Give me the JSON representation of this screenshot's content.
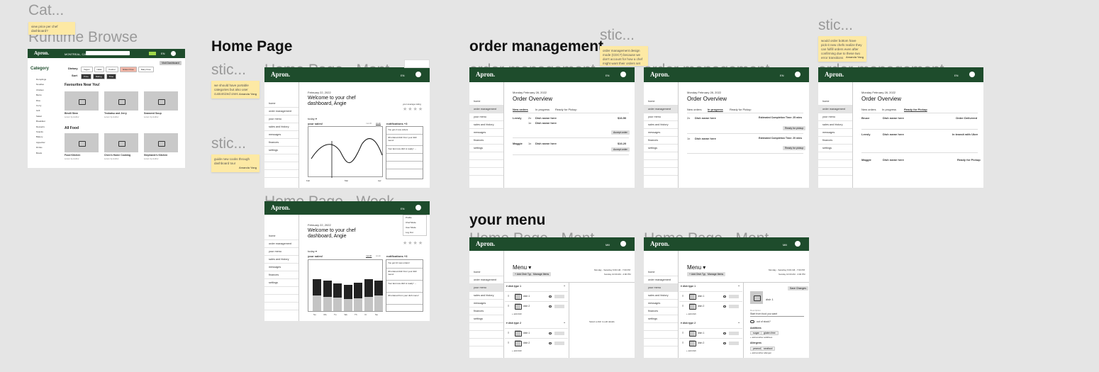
{
  "canvas_labels": {
    "cat": "Cat...",
    "runtime_browse": "Runtime Browse",
    "stic": "stic...",
    "home_mont": "Home Page - Mont",
    "home_week": "Home Page - Week",
    "order_mgmt": "order management",
    "menu_mont": "Home Page - Mont"
  },
  "sections": {
    "home": "Home Page",
    "order": "order management",
    "menu": "your menu"
  },
  "sticky": {
    "who": "Amanda May",
    "who2": "Amanda Yang"
  },
  "app": {
    "logo": "Apron.",
    "lang": "EN",
    "lang2": "Mili"
  },
  "browse": {
    "location": "MONTREAL, CA",
    "cart_label": "Visit Dashboard",
    "sidebar_title": "Category",
    "sidebar_items": [
      "Dumplings",
      "Noodles",
      "Chicken",
      "Bento",
      "Rice",
      "Curry",
      "Grill",
      "Salad",
      "Breakfast",
      "Desserts",
      "Snacks",
      "Bakery",
      "Appetizer",
      "Drinks",
      "Bowls"
    ],
    "dietary_label": "Dietary",
    "dietary_chips": [
      "Vegan",
      "Halal",
      "Kosher",
      "Gluten Free",
      "Dairy Free"
    ],
    "sort_label": "Sort",
    "sort_chips": [
      "Price",
      "Rating",
      "Time"
    ],
    "fav_title": "Favourites Near You!",
    "all_title": "All Food",
    "fav_cards": [
      {
        "name": "Bindli Stew",
        "sub": "Lorem by Author"
      },
      {
        "name": "Teokatsu and Jerry",
        "sub": "Lorem by Author"
      },
      {
        "name": "Seaweed Soup",
        "sub": "Lorem by Author"
      }
    ],
    "all_cards": [
      {
        "name": "Food Kitchen",
        "sub": "Lorem by Author"
      },
      {
        "name": "Chen's Home Cooking",
        "sub": "Lorem by Author"
      },
      {
        "name": "Stephanie's Kitchen",
        "sub": "Lorem by Author"
      }
    ]
  },
  "home_nav": [
    "home",
    "order management",
    "your menu",
    "sales and history",
    "messages",
    "finances",
    "settings"
  ],
  "home_month": {
    "date": "February 22, 2022",
    "welcome_line1": "Welcome to your chef",
    "welcome_line2": "dashboard, Angie",
    "rating_label": "your average rating",
    "period": "today",
    "sales_label": "your sales!",
    "tab_month": "month",
    "tab_week": "week",
    "notif": "notifications +3",
    "notif_items": [
      "You got 2 new orders",
      "Jill ordered dish from your dish menu!",
      "Your last new dish is ready! →"
    ],
    "x_ticks": [
      "Feb",
      "Mar",
      "Apr"
    ]
  },
  "home_week": {
    "date": "February 22, 2022",
    "welcome_line1": "Welcome to your chef",
    "welcome_line2": "dashboard, Angie",
    "period": "today",
    "sales_label": "your sales!",
    "tab_month": "month",
    "tab_week": "week",
    "notif": "notifications +3",
    "notif_items": [
      "You got 10 new orders!",
      "Jill ordered dish from your dish menu!",
      "Your last new dish is ready! →",
      "Jill ordered from your dish menu!"
    ],
    "days": [
      "Su",
      "Mo",
      "Tu",
      "We",
      "Th",
      "Fr",
      "Sa"
    ],
    "dropdown": [
      "Profile",
      "Chef Mode",
      "User Mode",
      "Log Out"
    ]
  },
  "orders": {
    "date": "Monday February 28, 2022",
    "title": "Order Overview",
    "tabs": [
      "New orders",
      "In progress",
      "Ready for Pickup"
    ],
    "customers": [
      {
        "name": "Leesly",
        "items": [
          {
            "qty": "2x",
            "dish": "Dish name here"
          },
          {
            "qty": "1x",
            "dish": "Dish name here"
          }
        ],
        "price": "$16.50",
        "btn": "Accept order"
      },
      {
        "name": "Maggie",
        "items": [
          {
            "qty": "1x",
            "dish": "Dish name here"
          }
        ],
        "price": "$16.20",
        "btn": "Accept order"
      }
    ],
    "progress": [
      {
        "qty": "2x",
        "dish": "Dish name here",
        "eta": "Estimated Completion Time: 25 mins",
        "btn": "Ready for pickup"
      },
      {
        "qty": "1x",
        "dish": "Dish name here",
        "eta": "Estimated Completion Time: 20 mins",
        "btn": "Ready for pickup"
      }
    ],
    "pickup": [
      {
        "name": "Bruce",
        "dish": "Dish name here",
        "status": "Order Delivered"
      },
      {
        "name": "Leesly",
        "dish": "Dish name here",
        "status": "In transit with Uber"
      },
      {
        "name": "Maggie",
        "dish": "Dish name here",
        "status": "Ready for Pickup"
      }
    ]
  },
  "menu": {
    "title": "Menu",
    "add_btn": "+ Add Dish Type",
    "manage_btn": "Manage Items",
    "hours1": "Monday - Saturday 9:00 AM - 7:00 PM",
    "hours2": "Sunday 10:00 AM - 4:00 PM",
    "types": [
      {
        "name": "dish type 1",
        "dishes": [
          "dish 1",
          "dish 2"
        ]
      },
      {
        "name": "dish type 2",
        "dishes": [
          "dish 1",
          "dish 2"
        ]
      }
    ],
    "add_dish": "+ add dish",
    "empty_hint": "Select a dish to edit details",
    "editor": {
      "save": "Save Changes",
      "name": "dish 1",
      "desc_label": "Description",
      "desc": "Start from food you want",
      "out_of_stock": "out of stock?",
      "additives_label": "Additives",
      "additives": [
        "sugar",
        "gluten free"
      ],
      "allergens_label": "Allergens",
      "allergens": [
        "peanut",
        "seafood"
      ],
      "add_additive": "+ add another additives",
      "add_allergen": "+ add another allergen"
    }
  }
}
